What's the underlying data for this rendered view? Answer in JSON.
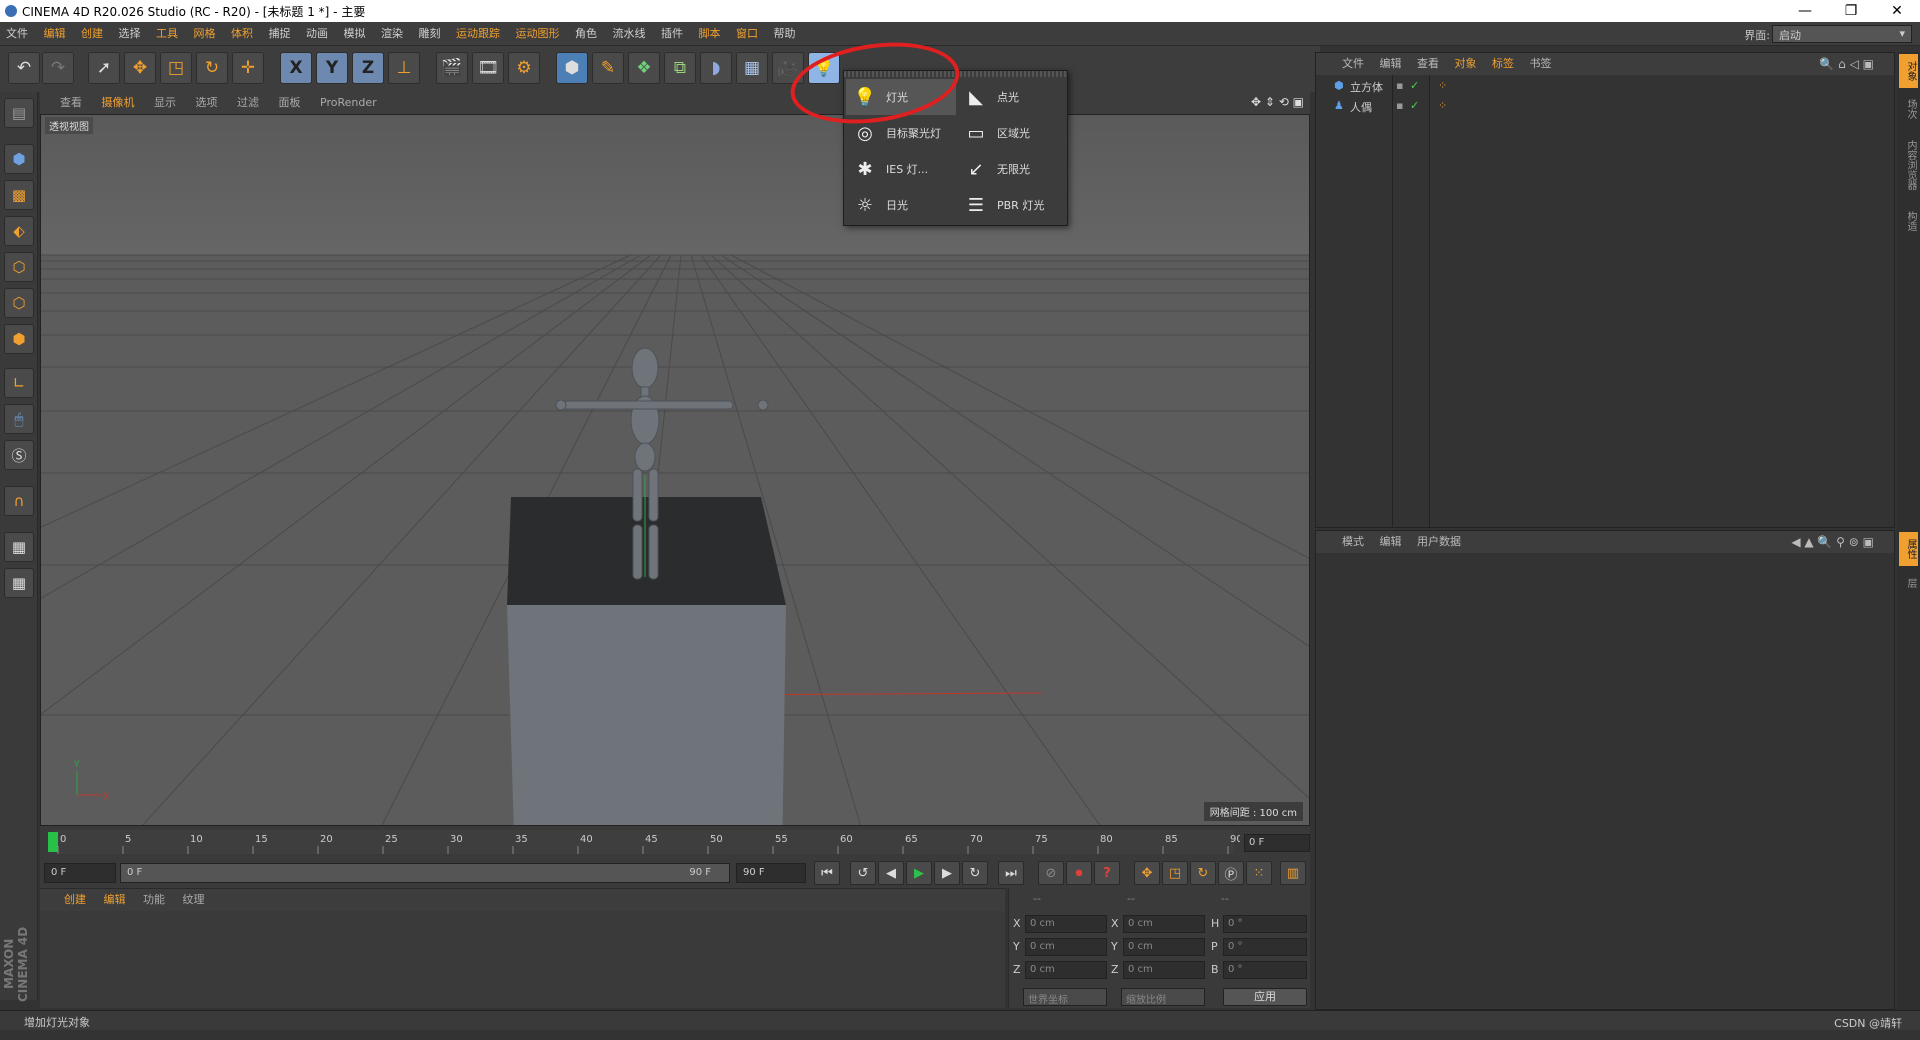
{
  "window": {
    "title": "CINEMA 4D R20.026 Studio (RC - R20) - [未标题 1 *] - 主要",
    "minimize": "—",
    "maximize": "❐",
    "close": "✕"
  },
  "menubar": {
    "items": [
      "文件",
      "编辑",
      "创建",
      "选择",
      "工具",
      "网格",
      "体积",
      "捕捉",
      "动画",
      "模拟",
      "渲染",
      "雕刻",
      "运动跟踪",
      "运动图形",
      "角色",
      "流水线",
      "插件",
      "脚本",
      "窗口",
      "帮助"
    ],
    "layout_label": "界面:",
    "layout_value": "启动"
  },
  "viewport": {
    "menu": [
      "查看",
      "摄像机",
      "显示",
      "选项",
      "过滤",
      "面板",
      "ProRender"
    ],
    "label": "透视视图",
    "grid_info": "网格间距 : 100 cm"
  },
  "light_menu": {
    "items": [
      {
        "label": "灯光",
        "icon": "bulb-icon"
      },
      {
        "label": "点光",
        "icon": "spot-light-icon"
      },
      {
        "label": "目标聚光灯",
        "icon": "target-spot-icon"
      },
      {
        "label": "区域光",
        "icon": "area-light-icon"
      },
      {
        "label": "IES 灯...",
        "icon": "ies-light-icon"
      },
      {
        "label": "无限光",
        "icon": "infinite-light-icon"
      },
      {
        "label": "日光",
        "icon": "sun-icon"
      },
      {
        "label": "PBR 灯光",
        "icon": "pbr-light-icon"
      }
    ]
  },
  "timeline": {
    "ticks": [
      "0",
      "5",
      "10",
      "15",
      "20",
      "25",
      "30",
      "35",
      "40",
      "45",
      "50",
      "55",
      "60",
      "65",
      "70",
      "75",
      "80",
      "85",
      "90"
    ],
    "current_frame": "0 F"
  },
  "transport": {
    "start_field": "0 F",
    "range_start": "0 F",
    "range_end": "90 F",
    "end_field": "90 F"
  },
  "material_panel": {
    "menu": [
      "创建",
      "编辑",
      "功能",
      "纹理"
    ]
  },
  "coordinates": {
    "headers": [
      "--",
      "--",
      "--"
    ],
    "rows": [
      {
        "a": "X",
        "av": "0 cm",
        "b": "X",
        "bv": "0 cm",
        "c": "H",
        "cv": "0 °"
      },
      {
        "a": "Y",
        "av": "0 cm",
        "b": "Y",
        "bv": "0 cm",
        "c": "P",
        "cv": "0 °"
      },
      {
        "a": "Z",
        "av": "0 cm",
        "b": "Z",
        "bv": "0 cm",
        "c": "B",
        "cv": "0 °"
      }
    ],
    "mode_world": "世界坐标",
    "mode_scale": "缩放比例",
    "apply": "应用"
  },
  "object_manager": {
    "menu": [
      "文件",
      "编辑",
      "查看",
      "对象",
      "标签",
      "书签"
    ],
    "objects": [
      {
        "name": "立方体",
        "icon": "cube-icon"
      },
      {
        "name": "人偶",
        "icon": "figure-icon"
      }
    ]
  },
  "attribute_manager": {
    "menu": [
      "模式",
      "编辑",
      "用户数据"
    ]
  },
  "right_tabs": [
    "对象",
    "场次",
    "内容浏览器",
    "构造"
  ],
  "right_tabs_lower": [
    "属性",
    "层"
  ],
  "status": {
    "text": "增加灯光对象",
    "watermark": "CSDN @靖轩"
  },
  "branding": "MAXON CINEMA 4D"
}
